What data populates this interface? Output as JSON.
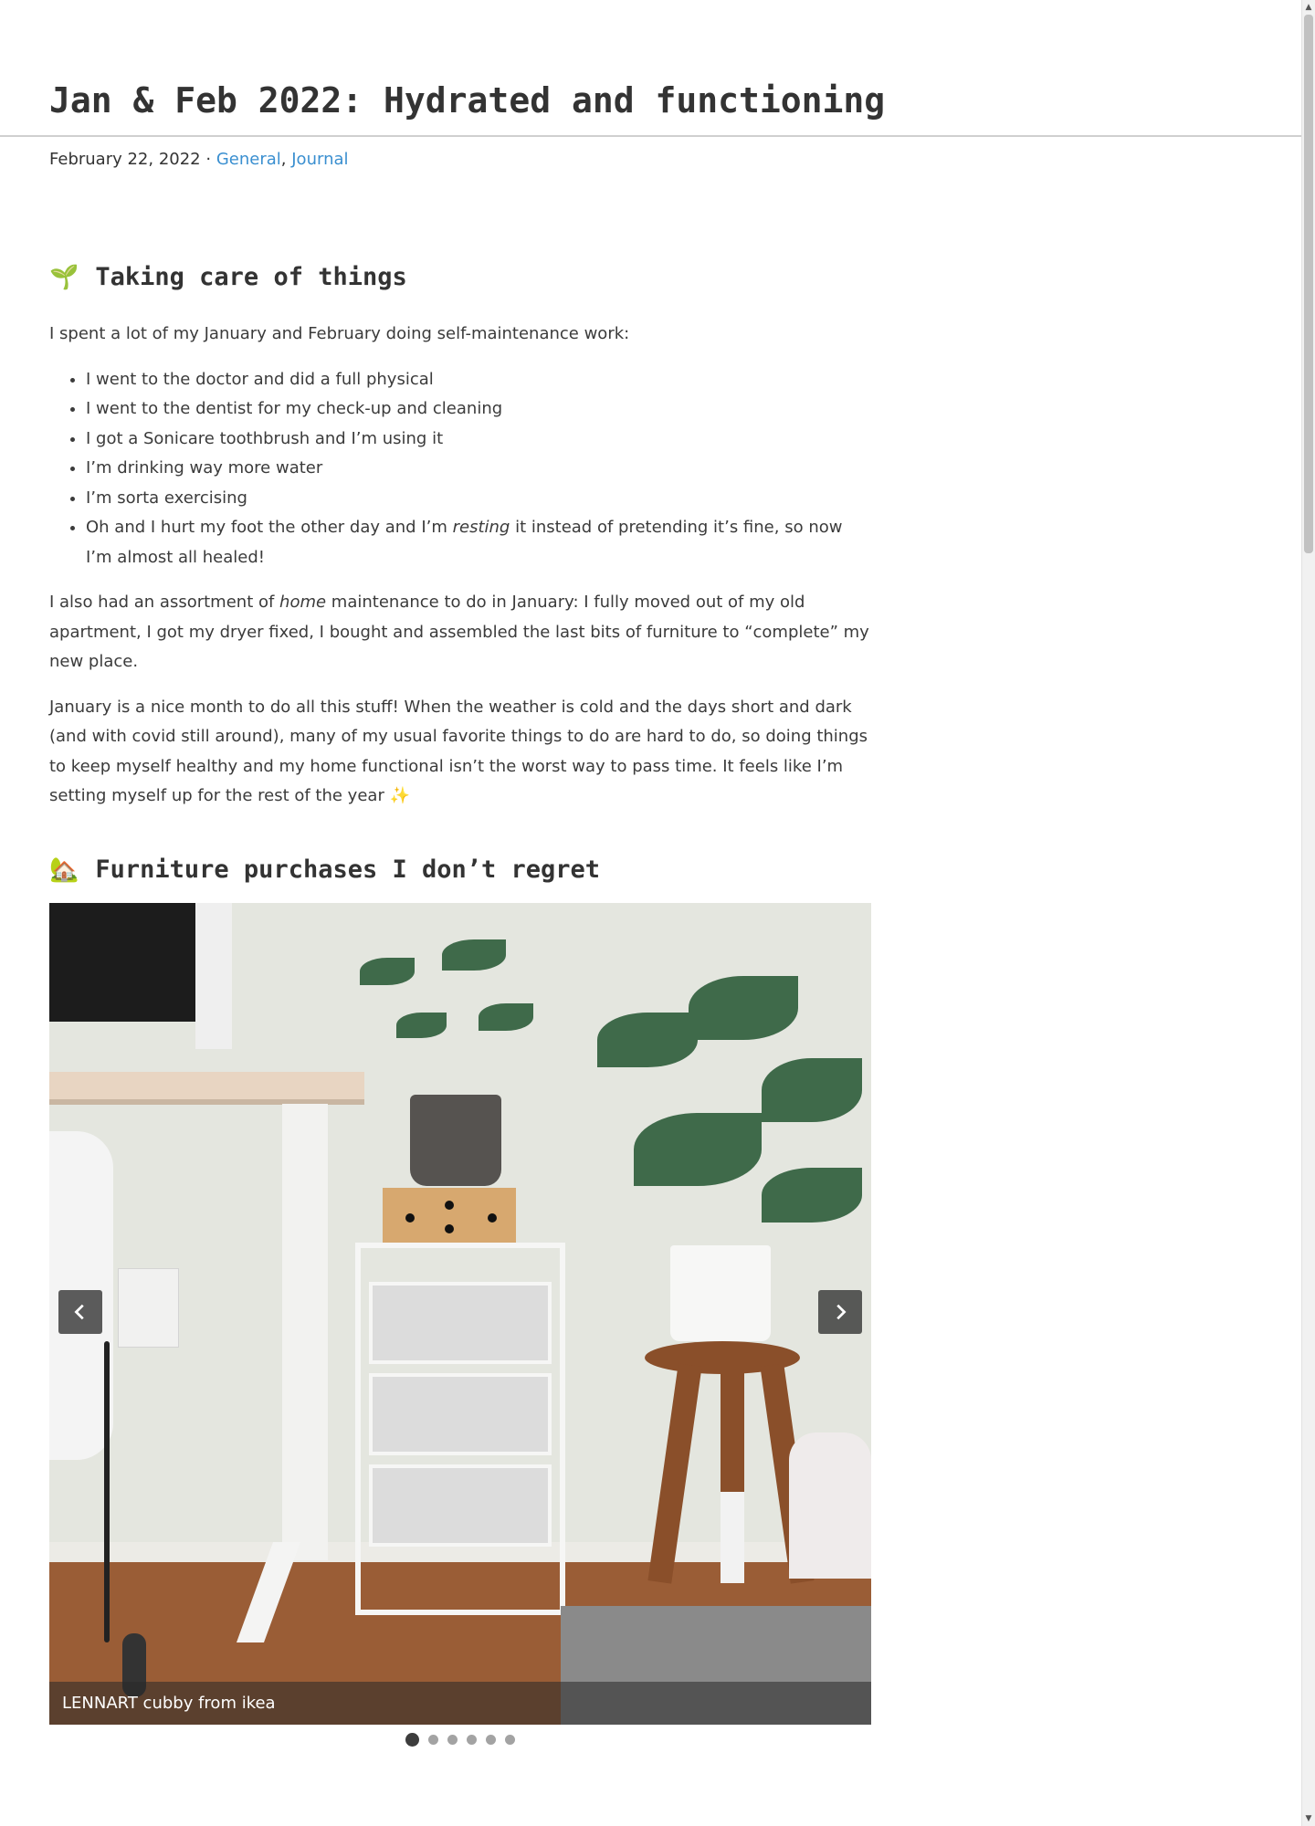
{
  "post": {
    "title": "Jan & Feb 2022: Hydrated and functioning",
    "date": "February 22, 2022",
    "separator": "·",
    "categories": [
      "General",
      "Journal"
    ],
    "category_comma": ","
  },
  "section1": {
    "emoji": "🌱",
    "heading": "Taking care of things",
    "intro": "I spent a lot of my January and February doing self-maintenance work:",
    "list": [
      "I went to the doctor and did a full physical",
      "I went to the dentist for my check-up and cleaning",
      "I got a Sonicare toothbrush and I’m using it",
      "I’m drinking way more water",
      "I’m sorta exercising"
    ],
    "last_item": {
      "before": "Oh and I hurt my foot the other day and I’m ",
      "em": "resting",
      "after": " it instead of pretending it’s fine, so now I’m almost all healed!"
    },
    "para2": {
      "before": "I also had an assortment of ",
      "em": "home",
      "after": " maintenance to do in January: I fully moved out of my old apartment, I got my dryer fixed, I bought and assembled the last bits of furniture to “complete” my new place."
    },
    "para3": "January is a nice month to do all this stuff! When the weather is cold and the days short and dark (and with covid still around), many of my usual favorite things to do are hard to do, so doing things to keep myself healthy and my home functional isn’t the worst way to pass time. It feels like I’m setting myself up for the rest of the year ✨"
  },
  "section2": {
    "emoji": "🏡",
    "heading": "Furniture purchases I don’t regret",
    "carousel": {
      "caption": "LENNART cubby from ikea",
      "prev_icon": "chevron-left-icon",
      "next_icon": "chevron-right-icon",
      "slide_count": 6,
      "active_index": 0
    }
  },
  "colors": {
    "link": "#3a8fd0",
    "text": "#3b3b3b"
  }
}
